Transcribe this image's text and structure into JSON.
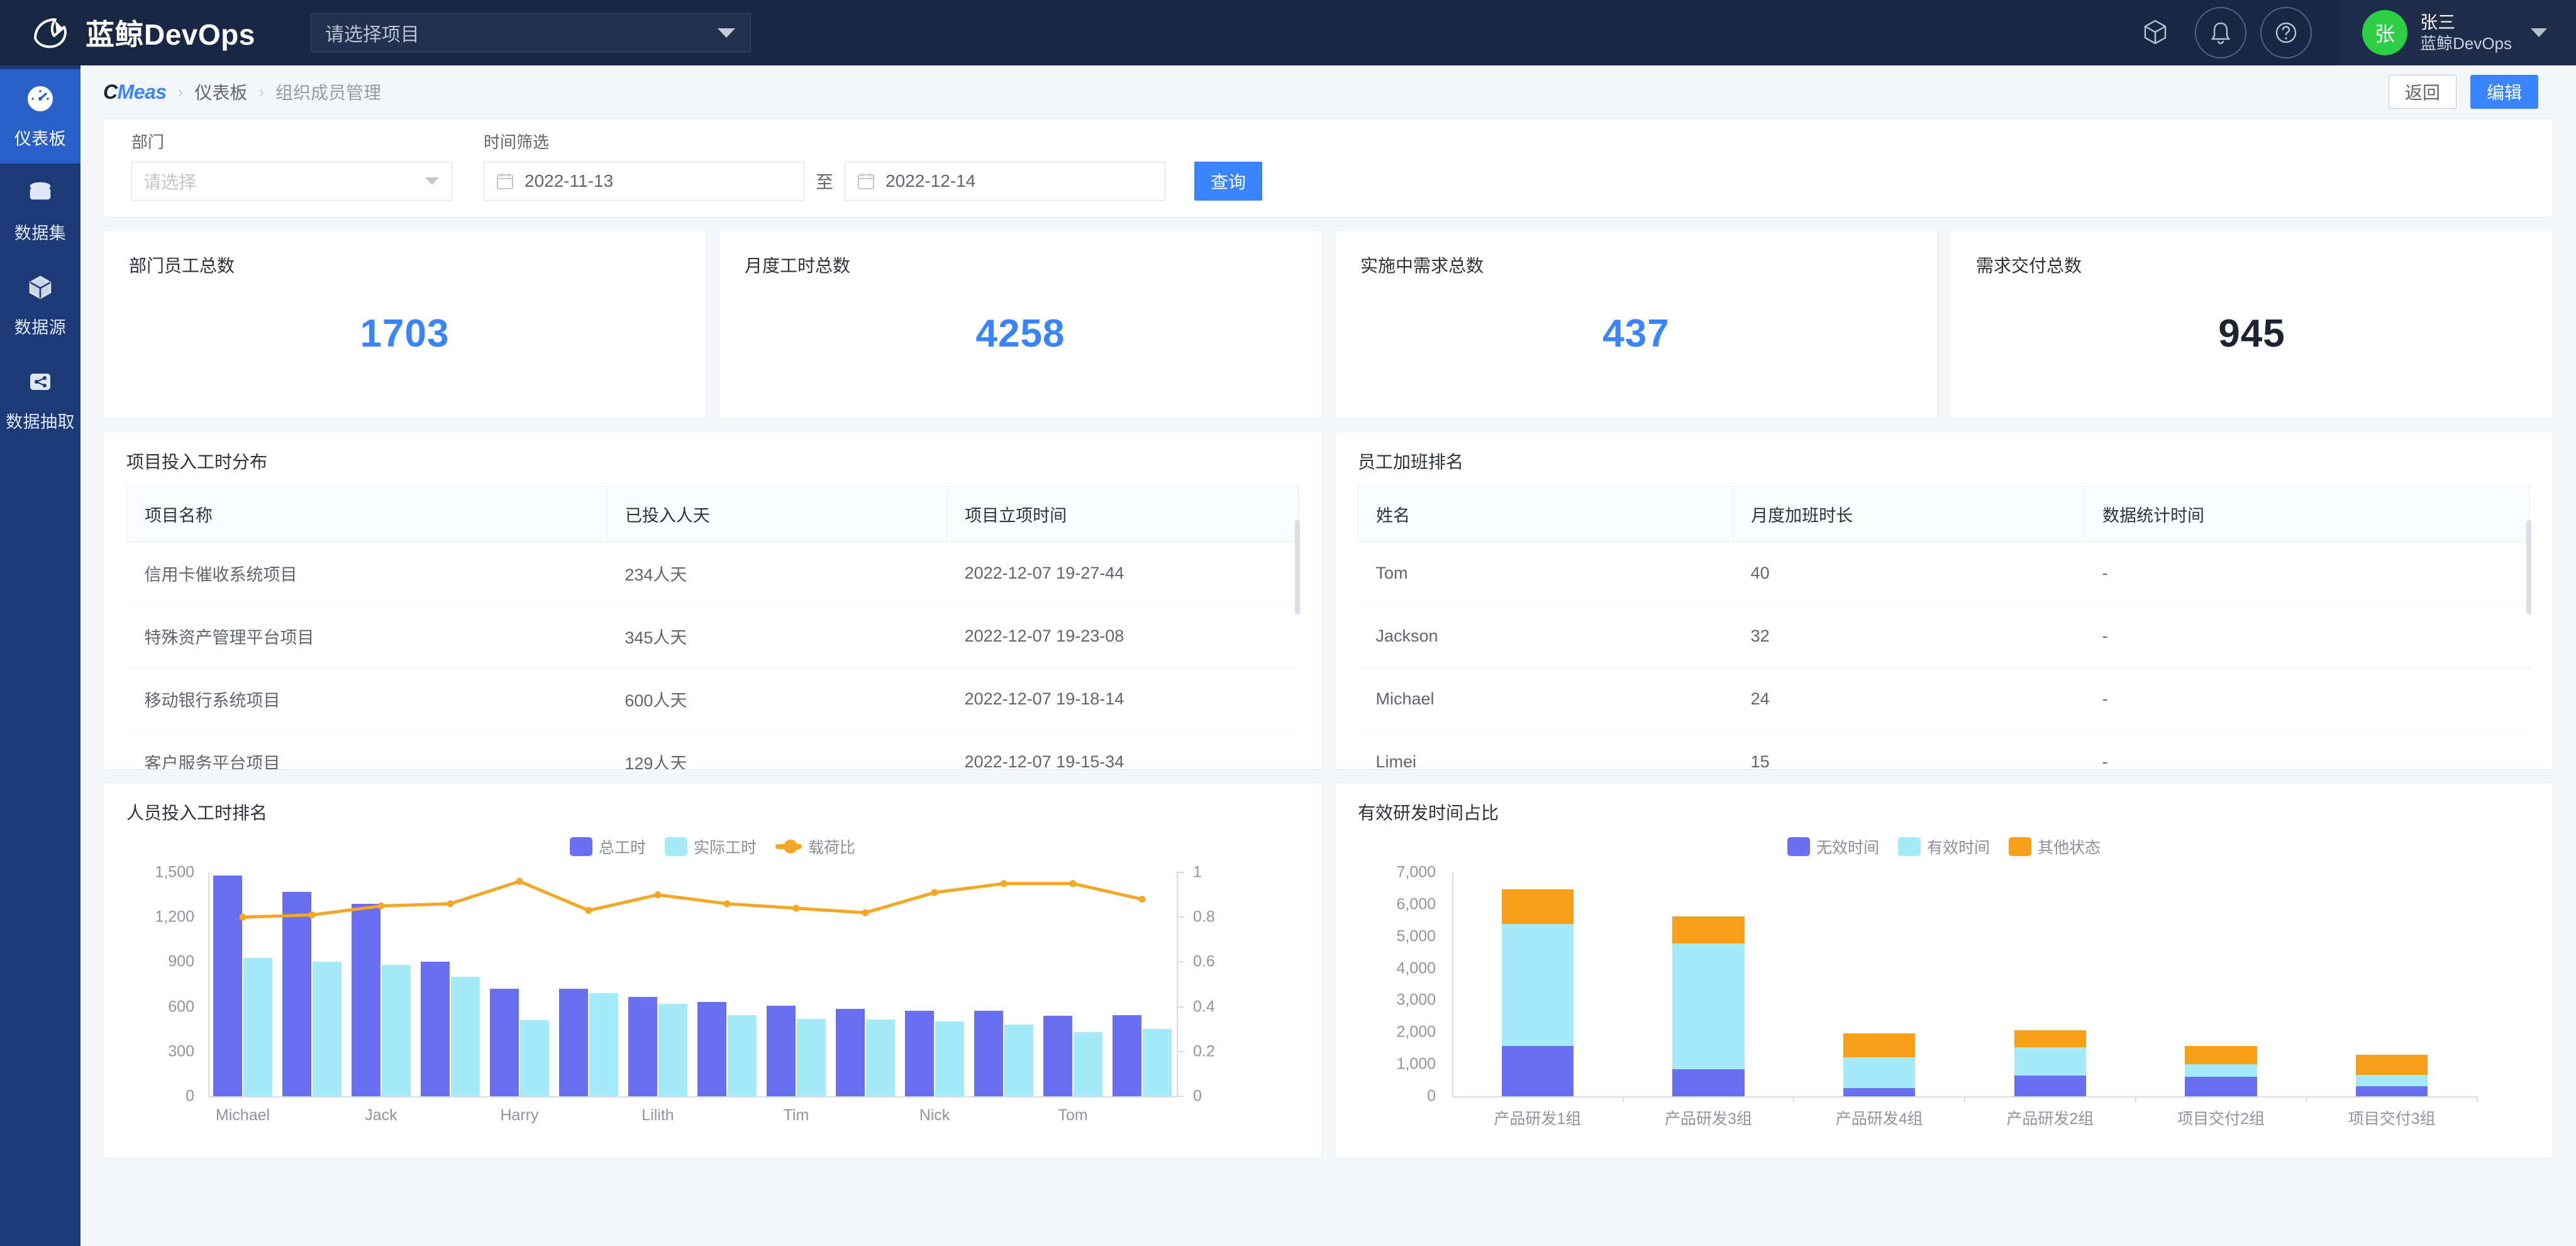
{
  "header": {
    "brand": "蓝鲸DevOps",
    "project_select": {
      "placeholder": "请选择项目"
    },
    "icons": [
      "cube-icon",
      "bell-icon",
      "help-icon"
    ],
    "user": {
      "avatar_initial": "张",
      "name": "张三",
      "org": "蓝鲸DevOps"
    }
  },
  "sidebar": {
    "items": [
      {
        "label": "仪表板",
        "icon": "dashboard-icon",
        "active": true
      },
      {
        "label": "数据集",
        "icon": "dataset-icon",
        "active": false
      },
      {
        "label": "数据源",
        "icon": "datasource-icon",
        "active": false
      },
      {
        "label": "数据抽取",
        "icon": "data-extract-icon",
        "active": false
      }
    ]
  },
  "breadcrumb": {
    "product_c": "C",
    "product_meas": "Meas",
    "items": [
      "仪表板",
      "组织成员管理"
    ],
    "back_label": "返回",
    "edit_label": "编辑"
  },
  "filters": {
    "department": {
      "label": "部门",
      "placeholder": "请选择",
      "value": ""
    },
    "time_range": {
      "label": "时间筛选",
      "start": "2022-11-13",
      "separator": "至",
      "end": "2022-12-14"
    },
    "query_label": "查询"
  },
  "kpis": [
    {
      "title": "部门员工总数",
      "value": "1703",
      "color": "#3a84ff"
    },
    {
      "title": "月度工时总数",
      "value": "4258",
      "color": "#3a84ff"
    },
    {
      "title": "实施中需求总数",
      "value": "437",
      "color": "#3a84ff"
    },
    {
      "title": "需求交付总数",
      "value": "945",
      "color": "#1d2433"
    }
  ],
  "project_table": {
    "title": "项目投入工时分布",
    "columns": [
      "项目名称",
      "已投入人天",
      "项目立项时间"
    ],
    "rows": [
      [
        "信用卡催收系统项目",
        "234人天",
        "2022-12-07 19-27-44"
      ],
      [
        "特殊资产管理平台项目",
        "345人天",
        "2022-12-07 19-23-08"
      ],
      [
        "移动银行系统项目",
        "600人天",
        "2022-12-07 19-18-14"
      ],
      [
        "客户服务平台项目",
        "129人天",
        "2022-12-07 19-15-34"
      ]
    ]
  },
  "overtime_table": {
    "title": "员工加班排名",
    "columns": [
      "姓名",
      "月度加班时长",
      "数据统计时间"
    ],
    "rows": [
      [
        "Tom",
        "40",
        "-"
      ],
      [
        "Jackson",
        "32",
        "-"
      ],
      [
        "Michael",
        "24",
        "-"
      ],
      [
        "Limei",
        "15",
        "-"
      ]
    ]
  },
  "chart_data": [
    {
      "type": "bar",
      "title": "人员投入工时排名",
      "xlabel": "",
      "ylabel": "",
      "grid": false,
      "legend_position": "top-center",
      "categories": [
        "Michael",
        "",
        "Jack",
        "",
        "Harry",
        "",
        "Lilith",
        "",
        "Tim",
        "",
        "Nick",
        "",
        "Tom",
        ""
      ],
      "x_tick_labels": [
        "Michael",
        "Jack",
        "Harry",
        "Lilith",
        "Tim",
        "Nick",
        "Tom"
      ],
      "ylim": [
        0,
        1500
      ],
      "yticks": [
        "0",
        "300",
        "600",
        "900",
        "1,200",
        "1,500"
      ],
      "y2lim": [
        0,
        1
      ],
      "y2ticks": [
        "0",
        "0.2",
        "0.4",
        "0.6",
        "0.8",
        "1"
      ],
      "series": [
        {
          "name": "总工时",
          "color": "#6a6ef0",
          "axis": "left",
          "values": [
            1480,
            1370,
            1290,
            900,
            720,
            720,
            665,
            630,
            605,
            585,
            575,
            575,
            540,
            545
          ]
        },
        {
          "name": "实际工时",
          "color": "#a5eaf8",
          "axis": "left",
          "values": [
            925,
            900,
            880,
            800,
            510,
            690,
            620,
            545,
            520,
            515,
            500,
            480,
            430,
            450
          ]
        },
        {
          "name": "载荷比",
          "color": "#f5a623",
          "axis": "right",
          "kind": "line",
          "values": [
            0.8,
            0.81,
            0.85,
            0.86,
            0.96,
            0.83,
            0.9,
            0.86,
            0.84,
            0.82,
            0.91,
            0.95,
            0.95,
            0.88
          ]
        }
      ]
    },
    {
      "type": "bar",
      "subtype": "stacked",
      "title": "有效研发时间占比",
      "xlabel": "",
      "ylabel": "",
      "grid": false,
      "legend_position": "top-center",
      "categories": [
        "产品研发1组",
        "产品研发3组",
        "产品研发4组",
        "产品研发2组",
        "项目交付2组",
        "项目交付3组"
      ],
      "ylim": [
        0,
        7000
      ],
      "yticks": [
        "0",
        "1,000",
        "2,000",
        "3,000",
        "4,000",
        "5,000",
        "6,000",
        "7,000"
      ],
      "series": [
        {
          "name": "无效时间",
          "color": "#6a6ef0",
          "values": [
            1580,
            840,
            250,
            640,
            610,
            310
          ]
        },
        {
          "name": "有效时间",
          "color": "#a5eaf8",
          "values": [
            3800,
            3930,
            960,
            900,
            390,
            360
          ]
        },
        {
          "name": "其他状态",
          "color": "#f9a01b",
          "values": [
            1080,
            850,
            760,
            530,
            580,
            630
          ]
        }
      ]
    }
  ]
}
